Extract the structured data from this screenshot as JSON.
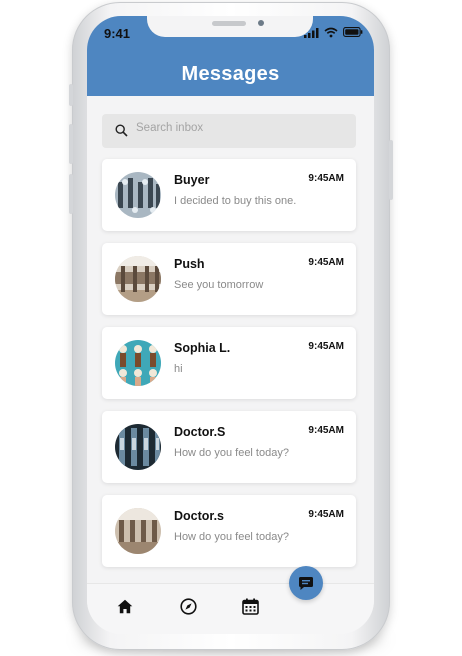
{
  "status_bar": {
    "time": "9:41"
  },
  "header": {
    "title": "Messages"
  },
  "search": {
    "placeholder": "Search inbox",
    "icon": "search-icon"
  },
  "conversations": [
    {
      "name": "Buyer",
      "message": "I decided to buy this one.",
      "time": "9:45AM"
    },
    {
      "name": "Push",
      "message": "See you tomorrow",
      "time": "9:45AM"
    },
    {
      "name": "Sophia L.",
      "message": "hi",
      "time": "9:45AM"
    },
    {
      "name": "Doctor.S",
      "message": "How do you feel today?",
      "time": "9:45AM"
    },
    {
      "name": "Doctor.s",
      "message": "How do you feel today?",
      "time": "9:45AM"
    }
  ],
  "bottom_nav": {
    "items": [
      {
        "icon": "home-icon"
      },
      {
        "icon": "compass-icon"
      },
      {
        "icon": "calendar-icon"
      }
    ],
    "fab_icon": "chat-bubble-icon"
  },
  "colors": {
    "accent": "#4e86c1",
    "background": "#f4f4f5",
    "card": "#ffffff"
  }
}
